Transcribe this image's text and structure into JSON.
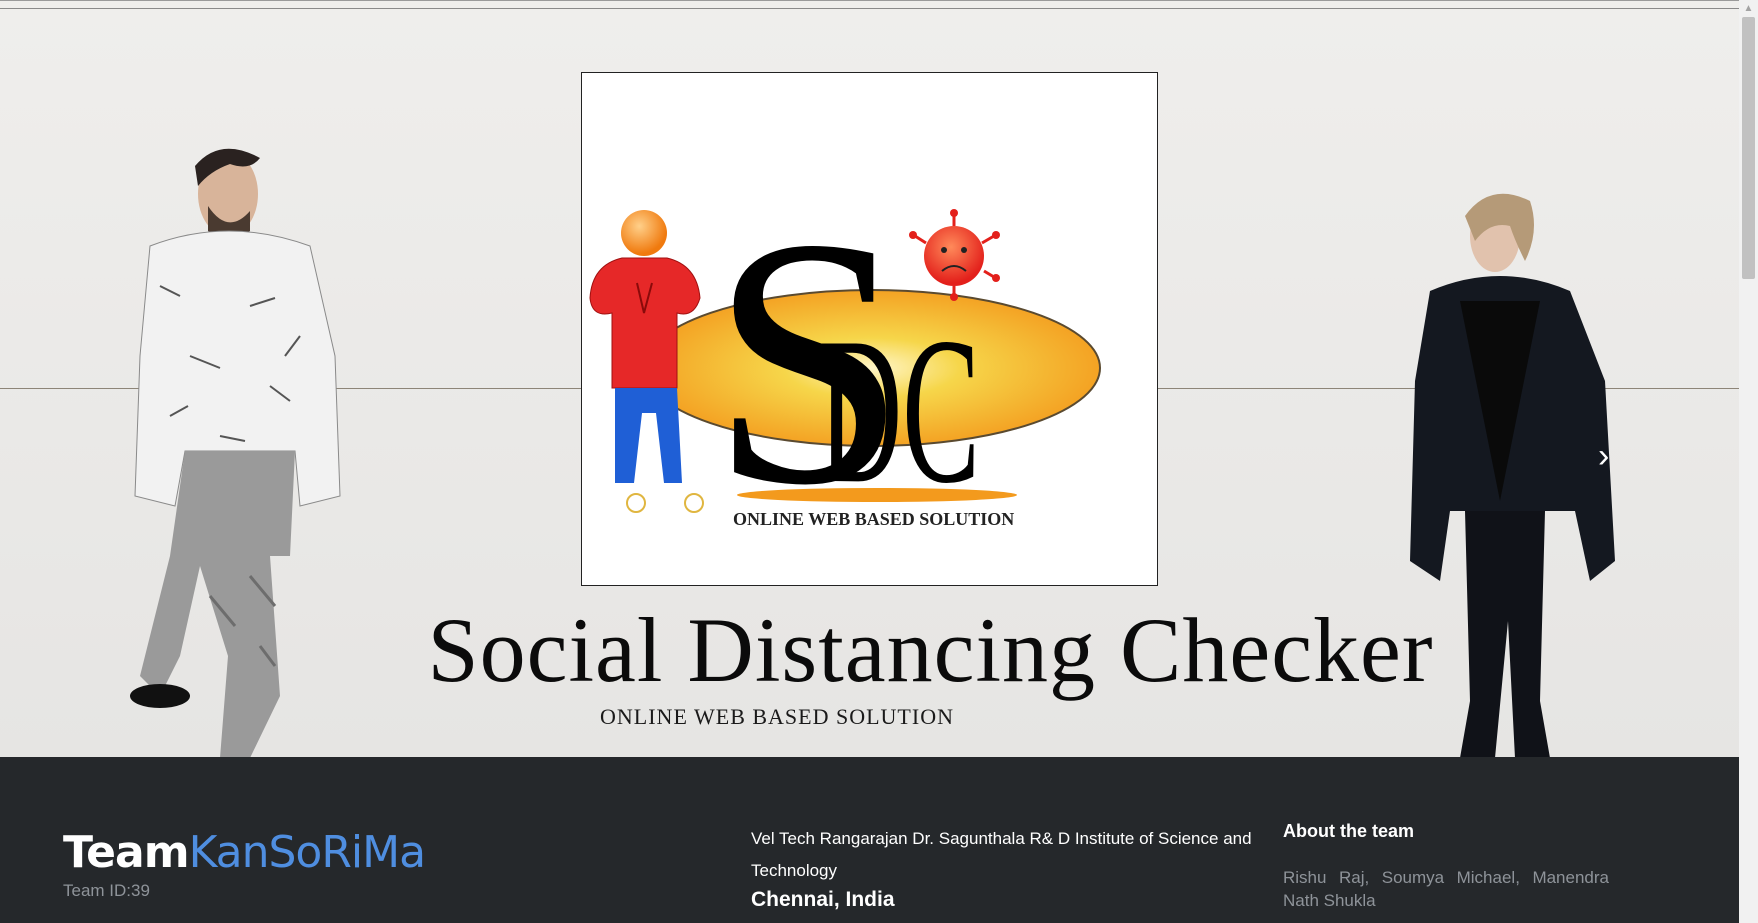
{
  "hero": {
    "title": "Social Distancing Checker",
    "subtitle": "ONLINE WEB BASED SOLUTION",
    "next_icon": "chevron-right-icon"
  },
  "logo": {
    "letters": "SDC",
    "tagline": "ONLINE WEB BASED SOLUTION",
    "colors": {
      "figure_body": "#e62828",
      "figure_head": "#f08a1e",
      "figure_legs": "#1f5fd6",
      "ellipse": "#f5a623",
      "virus": "#e3201b"
    }
  },
  "footer": {
    "brand_part1": "Team",
    "brand_part2": "KanSoRiMa",
    "team_id": "Team ID:39",
    "institute": "Vel Tech Rangarajan Dr. Sagunthala R& D Institute of Science and Technology",
    "city": "Chennai, India",
    "about_title": "About the team",
    "about_text": "Rishu Raj, Soumya Michael, Manendra Nath Shukla"
  },
  "colors": {
    "footer_bg": "#25282b",
    "brand_accent": "#4f8ee0",
    "muted_text": "#8e9399"
  }
}
